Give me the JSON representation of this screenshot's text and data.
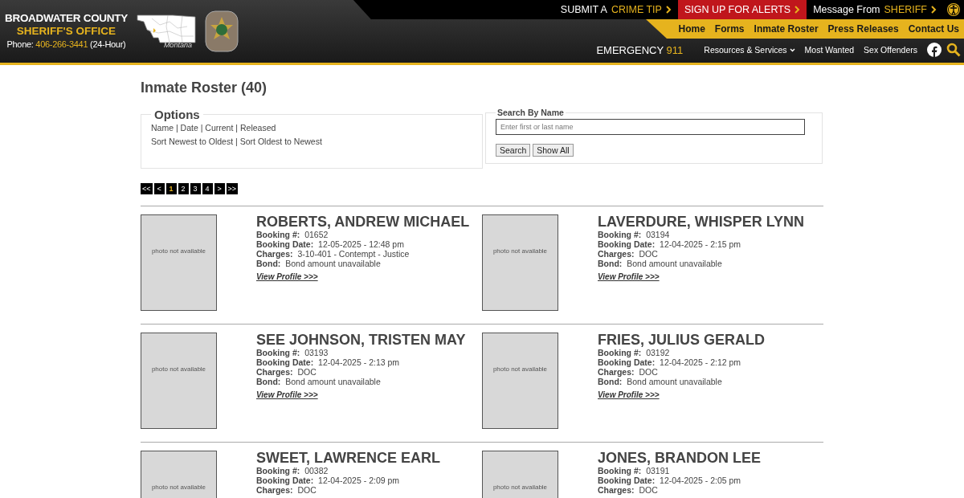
{
  "header": {
    "agency_line1": "BROADWATER COUNTY",
    "agency_line2": "SHERIFF'S OFFICE",
    "phone": {
      "label": "Phone:",
      "number": "406-266-3441",
      "note": "(24-Hour)"
    },
    "map_label": "Montana",
    "top_links": [
      {
        "lead": "SUBMIT A",
        "accent": "CRIME TIP",
        "highlight": false
      },
      {
        "lead": "SIGN UP FOR ALERTS",
        "highlight": true
      },
      {
        "lead": "Message From",
        "accent": "SHERIFF",
        "highlight": false
      }
    ],
    "main_nav": [
      {
        "label": "Home"
      },
      {
        "label": "Forms"
      },
      {
        "label": "Inmate Roster"
      },
      {
        "label": "Press Releases"
      },
      {
        "label": "Contact Us"
      }
    ],
    "emergency": {
      "lead": "EMERGENCY",
      "accent": "911"
    },
    "sub_nav": [
      {
        "label": "Resources & Services",
        "dropdown": true
      },
      {
        "label": "Most Wanted",
        "dropdown": false
      },
      {
        "label": "Sex Offenders",
        "dropdown": false
      }
    ]
  },
  "page_title": "Inmate Roster (40)",
  "options": {
    "legend": "Options",
    "separator": "|",
    "filters": [
      "Name",
      "Date",
      "Current",
      "Released"
    ],
    "sorts": [
      "Sort Newest to Oldest",
      "Sort Oldest to Newest"
    ]
  },
  "search": {
    "legend": "Search By Name",
    "placeholder": "Enter first or last name",
    "buttons": [
      "Search",
      "Show All"
    ]
  },
  "pagination": [
    {
      "label": "<<",
      "selected": false
    },
    {
      "label": "<",
      "selected": false
    },
    {
      "label": "1",
      "selected": true
    },
    {
      "label": "2",
      "selected": false
    },
    {
      "label": "3",
      "selected": false
    },
    {
      "label": "4",
      "selected": false
    },
    {
      "label": ">",
      "selected": false
    },
    {
      "label": ">>",
      "selected": false
    }
  ],
  "inmates": [
    {
      "photo_text": "photo not available",
      "name": "ROBERTS, ANDREW MICHAEL",
      "booking_label": "Booking #:",
      "booking": "01652",
      "date_label": "Booking Date:",
      "date": "12-05-2025 - 12:48 pm",
      "charges_label": "Charges:",
      "charges": "3-10-401 - Contempt - Justice",
      "bond_label": "Bond:",
      "bond": "Bond amount unavailable",
      "link": "View Profile >>>"
    },
    {
      "photo_text": "photo not available",
      "name": "LAVERDURE, WHISPER LYNN",
      "booking_label": "Booking #:",
      "booking": "03194",
      "date_label": "Booking Date:",
      "date": "12-04-2025 - 2:15 pm",
      "charges_label": "Charges:",
      "charges": "DOC",
      "bond_label": "Bond:",
      "bond": "Bond amount unavailable",
      "link": "View Profile >>>"
    },
    {
      "photo_text": "photo not available",
      "name": "SEE JOHNSON, TRISTEN MAY",
      "booking_label": "Booking #:",
      "booking": "03193",
      "date_label": "Booking Date:",
      "date": "12-04-2025 - 2:13 pm",
      "charges_label": "Charges:",
      "charges": "DOC",
      "bond_label": "Bond:",
      "bond": "Bond amount unavailable",
      "link": "View Profile >>>"
    },
    {
      "photo_text": "photo not available",
      "name": "FRIES, JULIUS GERALD",
      "booking_label": "Booking #:",
      "booking": "03192",
      "date_label": "Booking Date:",
      "date": "12-04-2025 - 2:12 pm",
      "charges_label": "Charges:",
      "charges": "DOC",
      "bond_label": "Bond:",
      "bond": "Bond amount unavailable",
      "link": "View Profile >>>"
    },
    {
      "photo_text": "photo not available",
      "name": "SWEET, LAWRENCE EARL",
      "booking_label": "Booking #:",
      "booking": "00382",
      "date_label": "Booking Date:",
      "date": "12-04-2025 - 2:09 pm",
      "charges_label": "Charges:",
      "charges": "DOC"
    },
    {
      "photo_text": "photo not available",
      "name": "JONES, BRANDON LEE",
      "booking_label": "Booking #:",
      "booking": "03191",
      "date_label": "Booking Date:",
      "date": "12-04-2025 - 2:05 pm",
      "charges_label": "Charges:",
      "charges": "DOC"
    }
  ]
}
